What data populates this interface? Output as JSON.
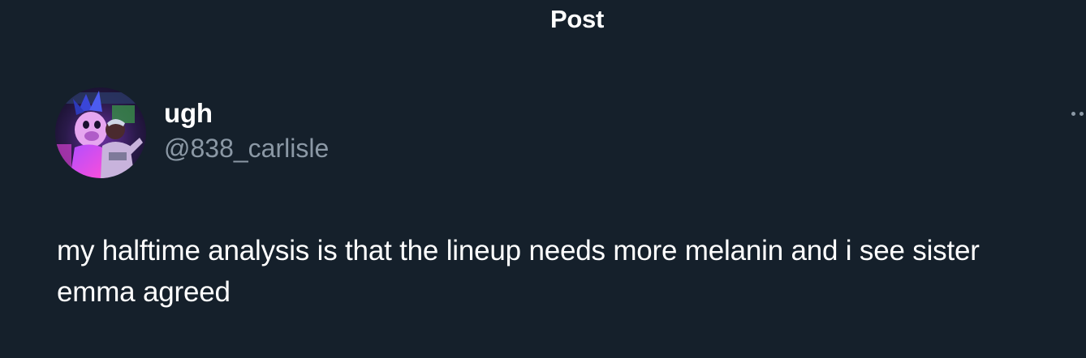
{
  "header": {
    "title": "Post"
  },
  "post": {
    "author": {
      "display_name": "ugh",
      "handle": "@838_carlisle",
      "avatar_icon": "user-avatar-photo"
    },
    "text": "my halftime analysis is that the lineup needs more melanin and i see sister emma agreed",
    "more_icon": "more-horizontal-icon"
  },
  "colors": {
    "background": "#15202b",
    "primary_text": "#ffffff",
    "secondary_text": "#8b98a5"
  }
}
